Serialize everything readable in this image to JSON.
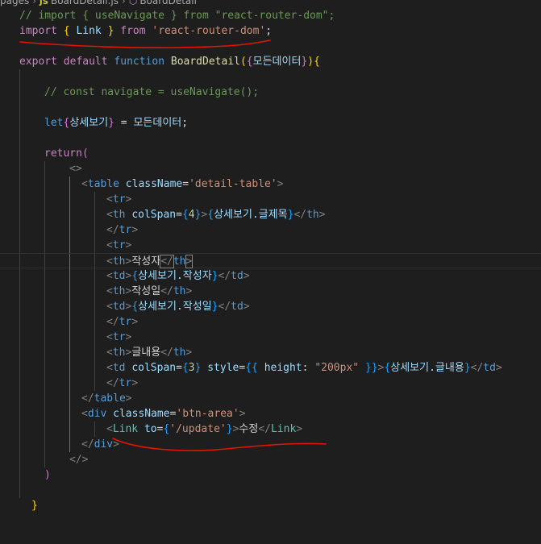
{
  "breadcrumb": {
    "folder": "pages",
    "file_badge": "JS",
    "file": "BoardDetail.js",
    "symbol": "BoardDetail"
  },
  "code": {
    "l1": {
      "comment": "// import { useNavigate } from \"react-router-dom\";"
    },
    "l2": {
      "import": "import",
      "open": "{",
      "name": "Link",
      "close": "}",
      "from": "from",
      "module": "'react-router-dom'",
      "semi": ";"
    },
    "l4": {
      "export": "export",
      "default": "default",
      "function": "function",
      "fname": "BoardDetail",
      "p1": "(",
      "b1": "{",
      "param": "모든데이터",
      "b2": "}",
      "p2": ")",
      "b3": "{"
    },
    "l6": {
      "comment": "// const navigate = useNavigate();"
    },
    "l8": {
      "let": "let",
      "b1": "{",
      "var": "상세보기",
      "b2": "}",
      "eq": " = ",
      "rhs": "모든데이터",
      "semi": ";"
    },
    "l10": {
      "ret": "return",
      "p": "("
    },
    "l11": {
      "frag": "<>"
    },
    "l12": {
      "lt": "<",
      "tag": "table",
      "attr": "className",
      "eq": "=",
      "val": "'detail-table'",
      "gt": ">"
    },
    "l13": {
      "open": "<",
      "tag": "tr",
      "close": ">"
    },
    "l14": {
      "lt": "<",
      "tag": "th",
      "attr": "colSpan",
      "eq": "=",
      "b1": "{",
      "num": "4",
      "b2": "}",
      "gt": ">",
      "eb1": "{",
      "expr": "상세보기.글제목",
      "eb2": "}",
      "end": "</",
      "etag": "th",
      "egt": ">"
    },
    "l15": {
      "open": "</",
      "tag": "tr",
      "close": ">"
    },
    "l16": {
      "open": "<",
      "tag": "tr",
      "close": ">"
    },
    "l17": {
      "lt": "<",
      "tag": "th",
      "gt": ">",
      "text": "작성자",
      "end": "</",
      "etag": "th",
      "egt": ">"
    },
    "l18": {
      "lt": "<",
      "tag": "td",
      "gt": ">",
      "b1": "{",
      "expr": "상세보기.작성자",
      "b2": "}",
      "end": "</",
      "etag": "td",
      "egt": ">"
    },
    "l19": {
      "lt": "<",
      "tag": "th",
      "gt": ">",
      "text": "작성일",
      "end": "</",
      "etag": "th",
      "egt": ">"
    },
    "l20": {
      "lt": "<",
      "tag": "td",
      "gt": ">",
      "b1": "{",
      "expr": "상세보기.작성일",
      "b2": "}",
      "end": "</",
      "etag": "td",
      "egt": ">"
    },
    "l21": {
      "open": "</",
      "tag": "tr",
      "close": ">"
    },
    "l22": {
      "open": "<",
      "tag": "tr",
      "close": ">"
    },
    "l23": {
      "lt": "<",
      "tag": "th",
      "gt": ">",
      "text": "글내용",
      "end": "</",
      "etag": "th",
      "egt": ">"
    },
    "l24": {
      "lt": "<",
      "tag": "td",
      "attr1": "colSpan",
      "eq1": "=",
      "b1": "{",
      "num": "3",
      "b2": "}",
      "attr2": "style",
      "eq2": "=",
      "sb1": "{{",
      "prop": "height",
      "colon": ": ",
      "sval": "\"200px\"",
      "sb2": "}}",
      "gt": ">",
      "eb1": "{",
      "expr": "상세보기.글내용",
      "eb2": "}",
      "end": "</",
      "etag": "td",
      "egt": ">"
    },
    "l25": {
      "open": "</",
      "tag": "tr",
      "close": ">"
    },
    "l26": {
      "open": "</",
      "tag": "table",
      "close": ">"
    },
    "l27": {
      "lt": "<",
      "tag": "div",
      "attr": "className",
      "eq": "=",
      "val": "'btn-area'",
      "gt": ">"
    },
    "l28": {
      "lt": "<",
      "tag": "Link",
      "attr": "to",
      "eq": "=",
      "b1": "{",
      "val": "'/update'",
      "b2": "}",
      "gt": ">",
      "text": "수정",
      "end": "</",
      "etag": "Link",
      "egt": ">"
    },
    "l29": {
      "open": "</",
      "tag": "div",
      "close": ">"
    },
    "l30": {
      "frag": "</>"
    },
    "l31": {
      "p": ")"
    },
    "l33": {
      "b": "}"
    }
  },
  "colors": {
    "background": "#1e1e1e",
    "annotation": "#e51400"
  }
}
